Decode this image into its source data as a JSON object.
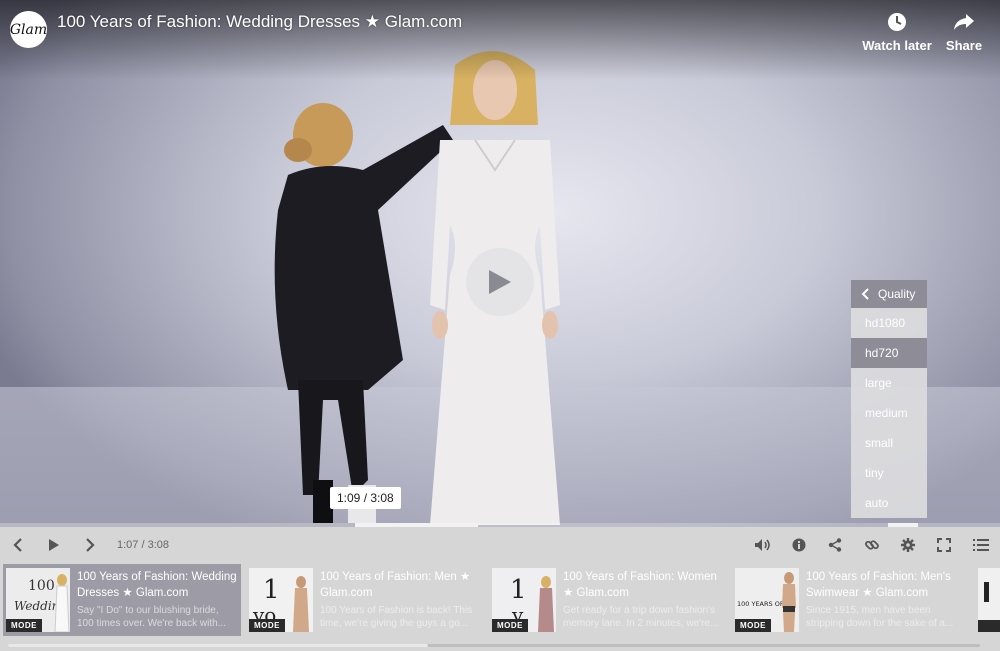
{
  "video": {
    "channel_logo_text": "Glam",
    "title": "100 Years of Fashion: Wedding Dresses ★ Glam.com",
    "watch_later": "Watch later",
    "share": "Share",
    "time_tooltip": "1:09 / 3:08",
    "progress": 0.36
  },
  "quality_menu": {
    "header": "Quality",
    "options": [
      "hd1080",
      "hd720",
      "large",
      "medium",
      "small",
      "tiny",
      "auto"
    ],
    "selected": "hd720"
  },
  "controls": {
    "time_display": "1:07 / 3:08"
  },
  "playlist": {
    "items": [
      {
        "title": "100 Years of Fashion: Wedding Dresses ★ Glam.com",
        "desc": "Say \"I Do\" to our blushing bride, 100 times over. We're back with...",
        "badge": "MODE",
        "thumb_text": "100 Wedding"
      },
      {
        "title": "100 Years of Fashion: Men ★ Glam.com",
        "desc": "100 Years of Fashion is back! This time, we're giving the guys a go...",
        "badge": "MODE",
        "thumb_text": "1 yo"
      },
      {
        "title": "100 Years of Fashion: Women ★ Glam.com",
        "desc": "Get ready for a trip down fashion's memory lane. In 2 minutes, we're...",
        "badge": "MODE",
        "thumb_text": "1 y"
      },
      {
        "title": "100 Years of Fashion: Men's Swimwear ★ Glam.com",
        "desc": "Since 1915, men have been stripping down for the sake of a...",
        "badge": "MODE",
        "thumb_text": "100 YEARS OF"
      }
    ]
  },
  "colors": {
    "menu_selected": "#8d8c97",
    "active_item": "#9d9ca6",
    "controls_bg": "#d6d6d6"
  }
}
